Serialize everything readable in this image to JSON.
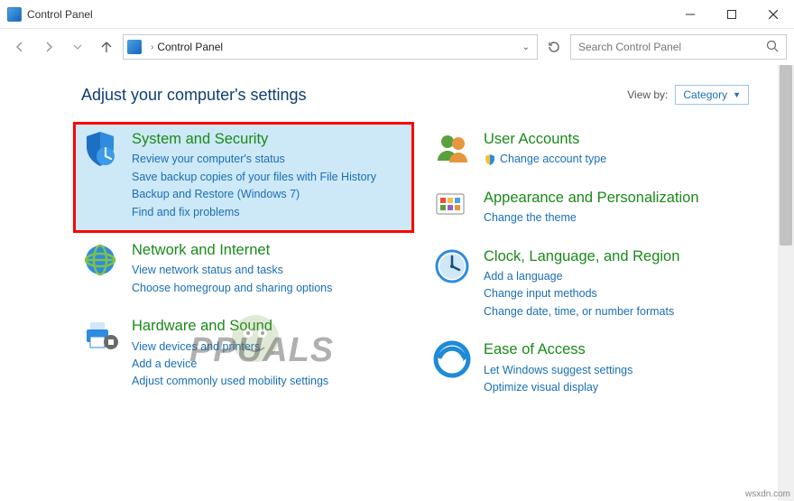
{
  "window": {
    "title": "Control Panel"
  },
  "address": {
    "path": "Control Panel"
  },
  "search": {
    "placeholder": "Search Control Panel"
  },
  "heading": "Adjust your computer's settings",
  "viewby": {
    "label": "View by:",
    "value": "Category"
  },
  "categories": {
    "system": {
      "title": "System and Security",
      "subs": [
        "Review your computer's status",
        "Save backup copies of your files with File History",
        "Backup and Restore (Windows 7)",
        "Find and fix problems"
      ]
    },
    "network": {
      "title": "Network and Internet",
      "subs": [
        "View network status and tasks",
        "Choose homegroup and sharing options"
      ]
    },
    "hardware": {
      "title": "Hardware and Sound",
      "subs": [
        "View devices and printers",
        "Add a device",
        "Adjust commonly used mobility settings"
      ]
    },
    "user": {
      "title": "User Accounts",
      "subs": [
        "Change account type"
      ]
    },
    "appearance": {
      "title": "Appearance and Personalization",
      "subs": [
        "Change the theme"
      ]
    },
    "clock": {
      "title": "Clock, Language, and Region",
      "subs": [
        "Add a language",
        "Change input methods",
        "Change date, time, or number formats"
      ]
    },
    "ease": {
      "title": "Ease of Access",
      "subs": [
        "Let Windows suggest settings",
        "Optimize visual display"
      ]
    }
  },
  "watermark": "PPUALS",
  "credit": "wsxdn.com"
}
